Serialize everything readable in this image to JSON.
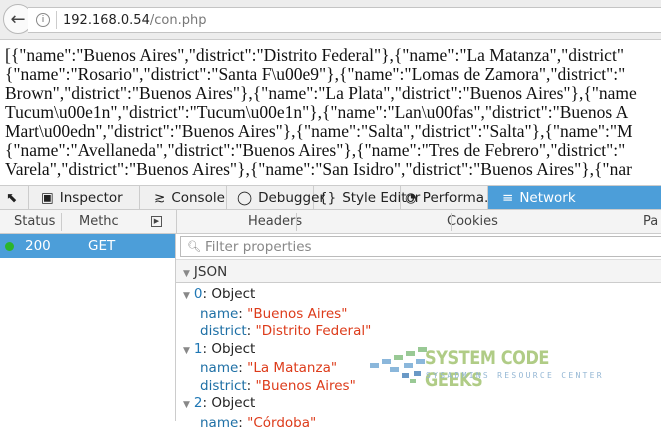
{
  "browser": {
    "url_host": "192.168.0.54",
    "url_path": "/con.php",
    "back_icon": "back-arrow-icon",
    "info_icon": "info-icon"
  },
  "raw_lines": [
    "[{\"name\":\"Buenos Aires\",\"district\":\"Distrito Federal\"},{\"name\":\"La Matanza\",\"district\"",
    "{\"name\":\"Rosario\",\"district\":\"Santa F\\u00e9\"},{\"name\":\"Lomas de Zamora\",\"district\":\"",
    "Brown\",\"district\":\"Buenos Aires\"},{\"name\":\"La Plata\",\"district\":\"Buenos Aires\"},{\"name",
    "Tucum\\u00e1n\",\"district\":\"Tucum\\u00e1n\"},{\"name\":\"Lan\\u00fas\",\"district\":\"Buenos A",
    "Mart\\u00edn\",\"district\":\"Buenos Aires\"},{\"name\":\"Salta\",\"district\":\"Salta\"},{\"name\":\"M",
    "{\"name\":\"Avellaneda\",\"district\":\"Buenos Aires\"},{\"name\":\"Tres de Febrero\",\"district\":\"",
    "Varela\",\"district\":\"Buenos Aires\"},{\"name\":\"San Isidro\",\"district\":\"Buenos Aires\"},{\"nar"
  ],
  "devtools": {
    "tabs": [
      {
        "label": "Inspector",
        "icon": "inspector-icon"
      },
      {
        "label": "Console",
        "icon": "console-icon"
      },
      {
        "label": "Debugger",
        "icon": "debugger-icon"
      },
      {
        "label": "Style Editor",
        "icon": "style-editor-icon"
      },
      {
        "label": "Performa...",
        "icon": "performance-icon"
      },
      {
        "label": "Network",
        "icon": "network-icon"
      }
    ],
    "columns": {
      "status": "Status",
      "method": "Methc"
    },
    "detail_tabs": [
      "Headers",
      "Cookies",
      "Pa"
    ],
    "request": {
      "status": "200",
      "method": "GET"
    },
    "filter_placeholder": "Filter properties",
    "json_header": "JSON",
    "objects": [
      {
        "index": "0",
        "type": "Object",
        "name": "\"Buenos Aires\"",
        "district": "\"Distrito Federal\""
      },
      {
        "index": "1",
        "type": "Object",
        "name": "\"La Matanza\"",
        "district": "\"Buenos Aires\""
      },
      {
        "index": "2",
        "type": "Object",
        "name": "\"Córdoba\""
      }
    ],
    "keys": {
      "name": "name",
      "district": "district"
    },
    "accent": "#4c9ed9"
  },
  "watermark": {
    "title": "SYSTEM CODE GEEKS",
    "subtitle": "SYSADMINS RESOURCE CENTER"
  }
}
